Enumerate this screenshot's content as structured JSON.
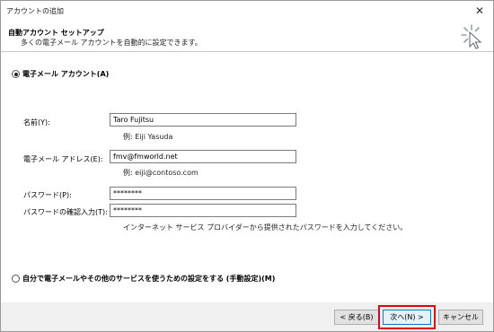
{
  "window": {
    "title": "アカウントの追加",
    "close_glyph": "✕"
  },
  "header": {
    "title": "自動アカウント セットアップ",
    "subtitle": "多くの電子メール アカウントを自動的に設定できます。",
    "icon": "wizard-cursor-icon"
  },
  "option_email": {
    "label": "電子メール アカウント(A)",
    "selected": true
  },
  "fields": {
    "name": {
      "label": "名前(Y):",
      "value": "Taro Fujitsu",
      "example": "例: Eiji Yasuda"
    },
    "email": {
      "label": "電子メール アドレス(E):",
      "value": "fmv@fmworld.net",
      "example": "例: eiji@contoso.com"
    },
    "password": {
      "label": "パスワード(P):",
      "value": "********"
    },
    "password_confirm": {
      "label": "パスワードの確認入力(T):",
      "value": "********"
    },
    "note": "インターネット サービス プロバイダーから提供されたパスワードを入力してください。"
  },
  "option_manual": {
    "label": "自分で電子メールやその他のサービスを使うための設定をする (手動設定)(M)",
    "selected": false
  },
  "buttons": {
    "back": "< 戻る(B)",
    "next": "次へ(N) >",
    "cancel": "キャンセル"
  },
  "colors": {
    "highlight": "#e0001b",
    "primary_border": "#0078d7",
    "footer_bg": "#f0f0f0"
  }
}
